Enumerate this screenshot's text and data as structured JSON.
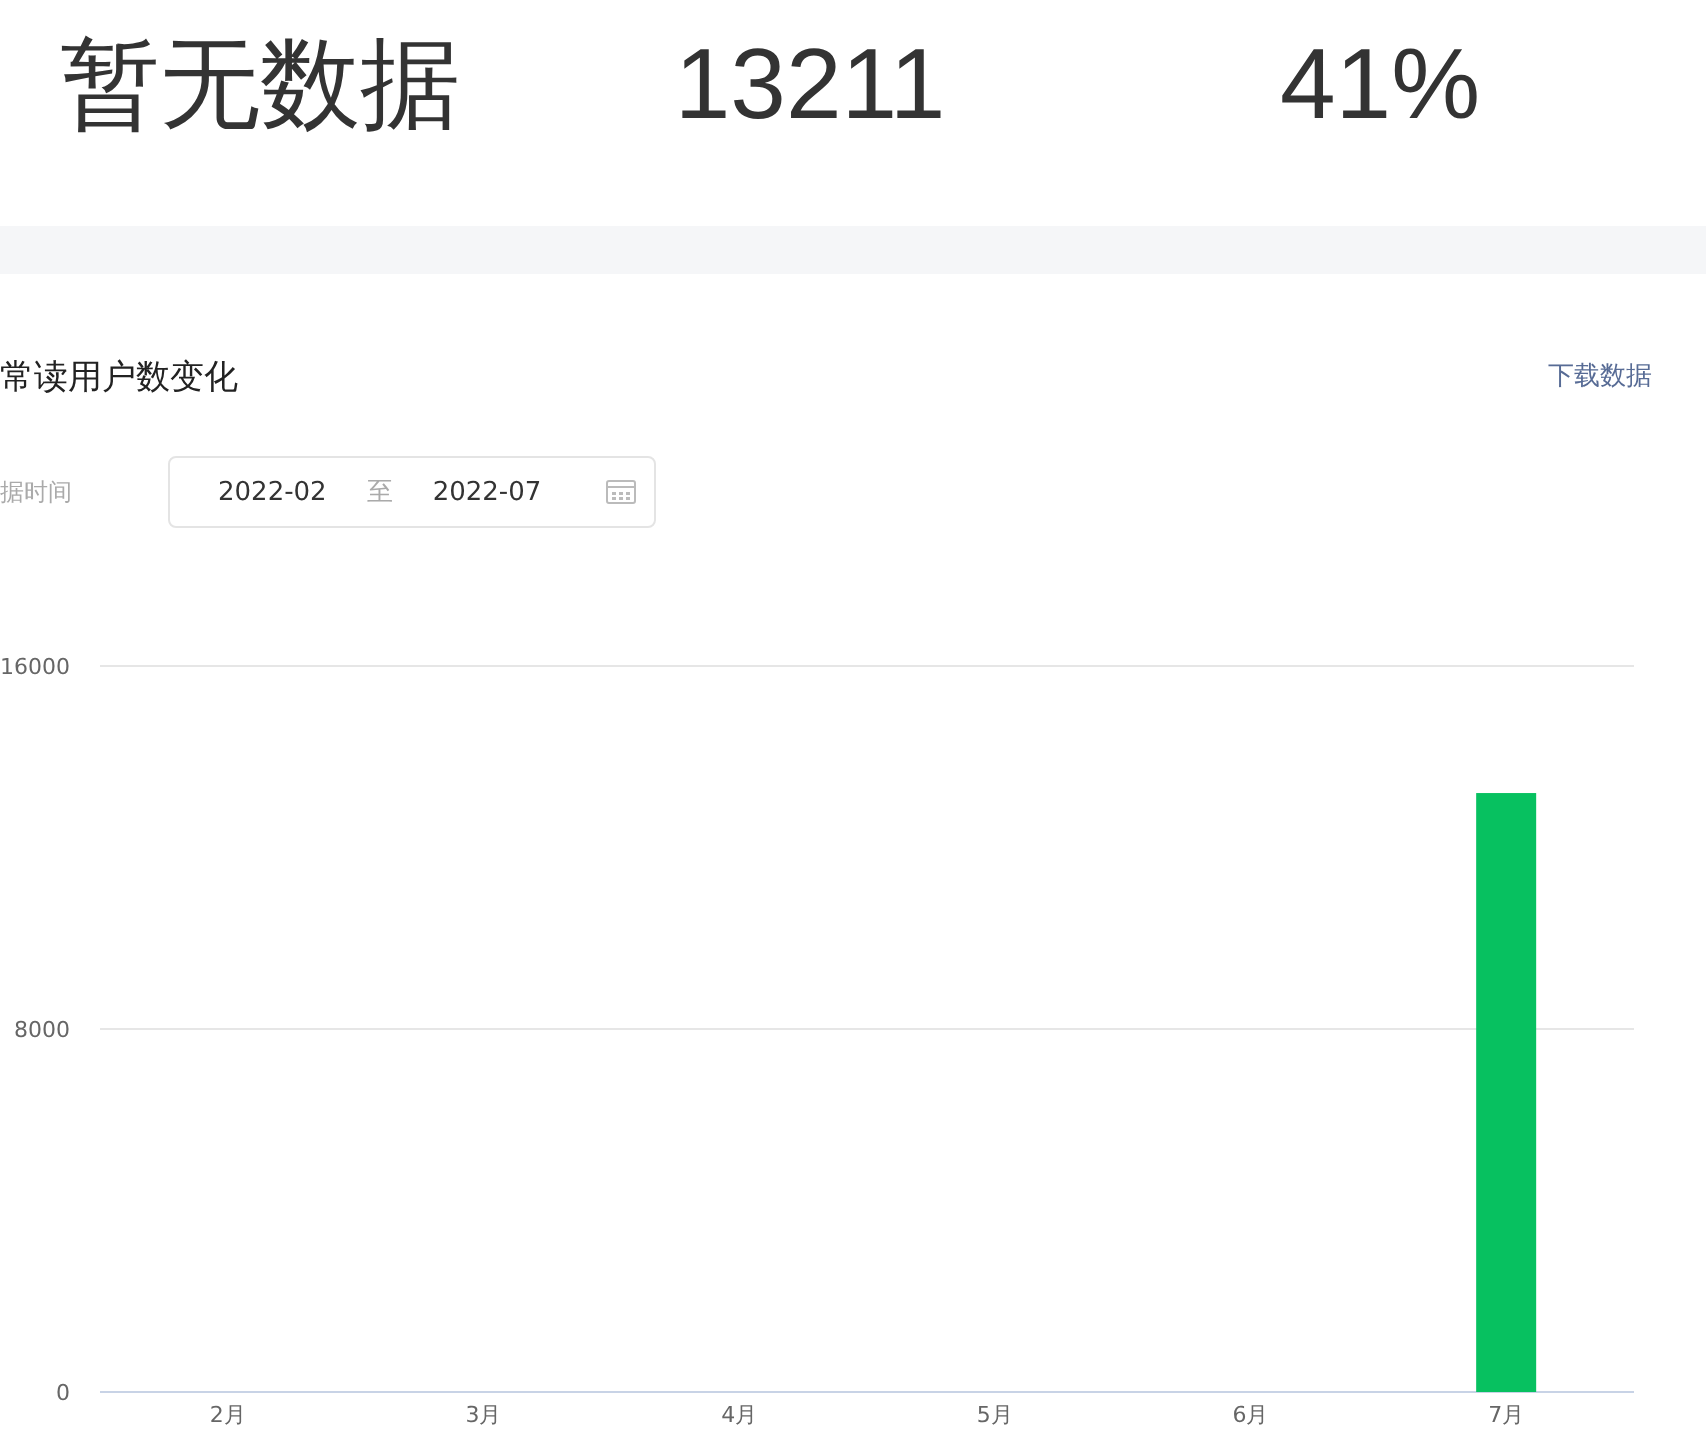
{
  "stats": [
    {
      "value": "暂无数据"
    },
    {
      "value": "13211"
    },
    {
      "value": "41%"
    }
  ],
  "panel": {
    "title": "常读用户数变化",
    "download_link": "下载数据",
    "date_label": "据时间",
    "date_range": {
      "start": "2022-02",
      "separator": "至",
      "end": "2022-07"
    },
    "chart_data": {
      "type": "bar",
      "categories": [
        "2月",
        "3月",
        "4月",
        "5月",
        "6月",
        "7月"
      ],
      "series": [
        {
          "color": "#07c160",
          "values": [
            0,
            0,
            0,
            0,
            0,
            13200
          ]
        }
      ],
      "ylim": [
        0,
        16000
      ],
      "yticks": [
        0,
        8000,
        16000
      ]
    }
  }
}
